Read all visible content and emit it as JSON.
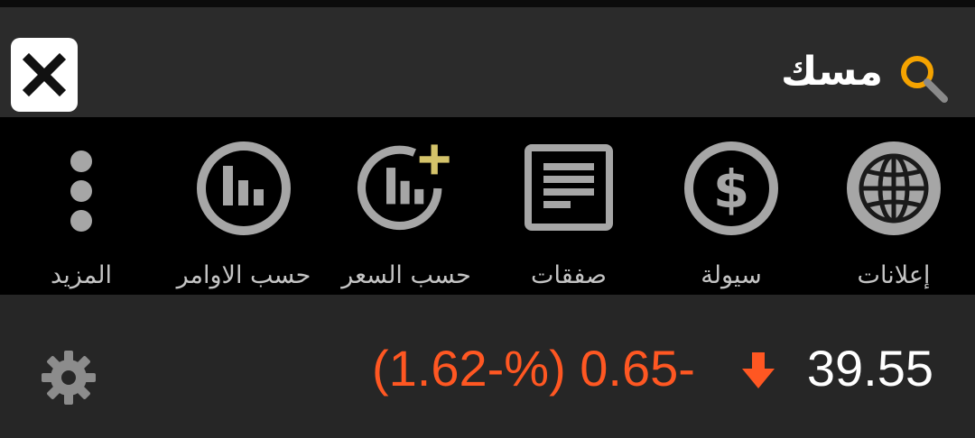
{
  "search": {
    "query": "مسك"
  },
  "actions": [
    {
      "id": "more",
      "label": "المزيد",
      "icon": "more-vertical-icon"
    },
    {
      "id": "by-orders",
      "label": "حسب الاوامر",
      "icon": "bar-chart-circle-icon"
    },
    {
      "id": "by-price",
      "label": "حسب السعر",
      "icon": "bar-chart-plus-icon"
    },
    {
      "id": "trades",
      "label": "صفقات",
      "icon": "document-lines-icon"
    },
    {
      "id": "liquidity",
      "label": "سيولة",
      "icon": "dollar-circle-icon"
    },
    {
      "id": "announcements",
      "label": "إعلانات",
      "icon": "globe-icon"
    }
  ],
  "quote": {
    "price": "39.55",
    "change": "(1.62-%) 0.65-",
    "direction": "down"
  },
  "colors": {
    "accent_down": "#ff5722",
    "search_icon": "#f5a300",
    "plus_icon": "#d4c36a",
    "icon_gray": "#a6a6a6"
  }
}
